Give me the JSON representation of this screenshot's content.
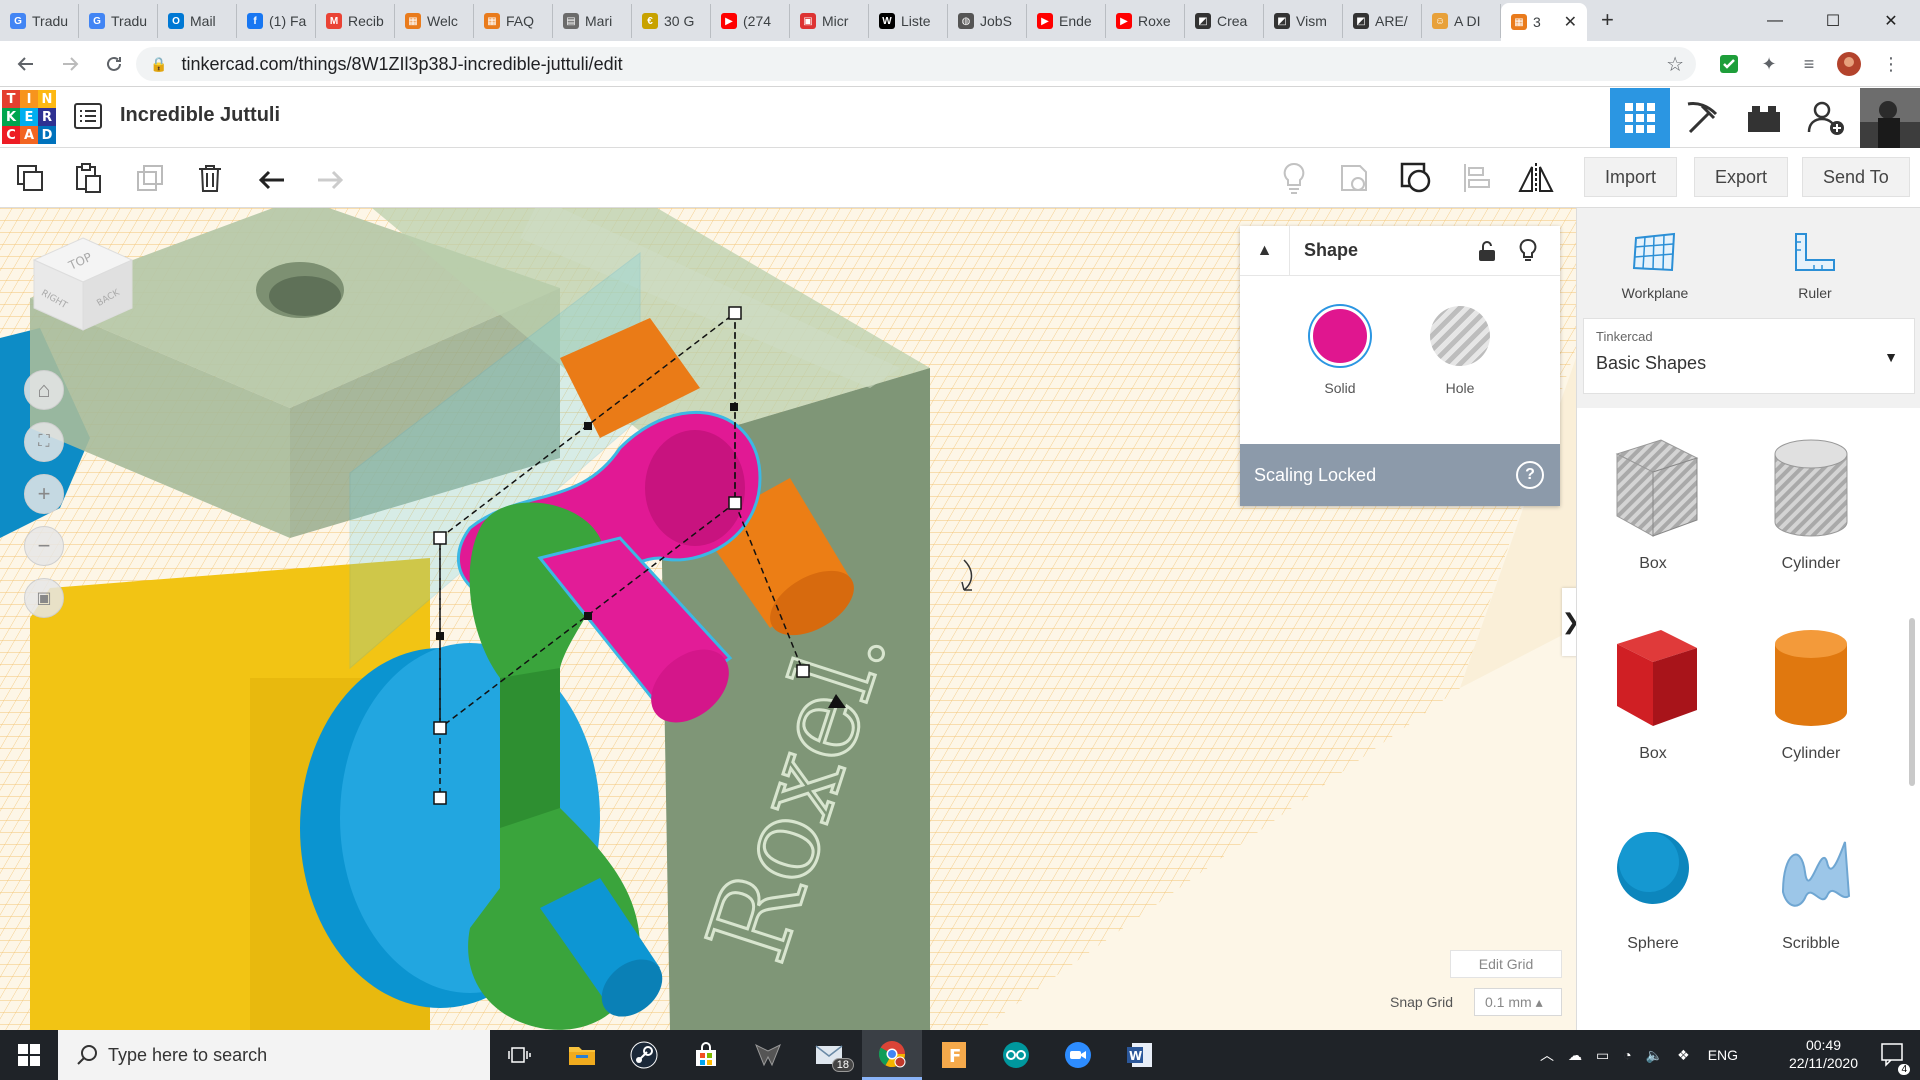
{
  "browser": {
    "tabs": [
      {
        "label": "Tradu",
        "color": "#4285f4",
        "glyph": "G"
      },
      {
        "label": "Tradu",
        "color": "#4285f4",
        "glyph": "G"
      },
      {
        "label": "Mail",
        "color": "#0078d4",
        "glyph": "O"
      },
      {
        "label": "(1) Fa",
        "color": "#1877f2",
        "glyph": "f"
      },
      {
        "label": "Recib",
        "color": "#ea4335",
        "glyph": "M"
      },
      {
        "label": "Welc",
        "color": "#e97b1c",
        "glyph": "▦"
      },
      {
        "label": "FAQ",
        "color": "#e97b1c",
        "glyph": "▦"
      },
      {
        "label": "Mari",
        "color": "#6b6b6b",
        "glyph": "▤"
      },
      {
        "label": "30 G",
        "color": "#c8a200",
        "glyph": "€"
      },
      {
        "label": "(274",
        "color": "#ff0000",
        "glyph": "▶"
      },
      {
        "label": "Micr",
        "color": "#d33",
        "glyph": "▣"
      },
      {
        "label": "Liste",
        "color": "#000",
        "glyph": "W"
      },
      {
        "label": "JobS",
        "color": "#555",
        "glyph": "◍"
      },
      {
        "label": "Ende",
        "color": "#ff0000",
        "glyph": "▶"
      },
      {
        "label": "Roxe",
        "color": "#ff0000",
        "glyph": "▶"
      },
      {
        "label": "Crea",
        "color": "#333",
        "glyph": "◩"
      },
      {
        "label": "Vism",
        "color": "#333",
        "glyph": "◩"
      },
      {
        "label": "ARE/",
        "color": "#333",
        "glyph": "◩"
      },
      {
        "label": "A DI",
        "color": "#e8a13a",
        "glyph": "☺"
      }
    ],
    "active_tab": {
      "label": "3",
      "color": "#e97b1c",
      "glyph": "▦",
      "close": "✕"
    },
    "new_tab": "+",
    "window_controls": {
      "minimize": "—",
      "maximize": "☐",
      "close": "✕"
    },
    "url": "tinkercad.com/things/8W1ZIl3p38J-incredible-juttuli/edit"
  },
  "app": {
    "logo_letters": [
      "T",
      "I",
      "N",
      "K",
      "E",
      "R",
      "C",
      "A",
      "D"
    ],
    "logo_colors": [
      "#e43f2f",
      "#f7941d",
      "#fdb813",
      "#00a54f",
      "#00aeef",
      "#2e3192",
      "#ed1c24",
      "#f26522",
      "#0072bc"
    ],
    "design_title": "Incredible Juttuli",
    "toolbar_buttons": {
      "import": "Import",
      "export": "Export",
      "send_to": "Send To"
    }
  },
  "inspector": {
    "title": "Shape",
    "solid_label": "Solid",
    "hole_label": "Hole",
    "solid_color": "#e0168f",
    "scaling_text": "Scaling Locked",
    "help": "?"
  },
  "grid": {
    "edit_grid": "Edit Grid",
    "snap_label": "Snap Grid",
    "snap_value": "0.1 mm ▴"
  },
  "panel": {
    "workplane": "Workplane",
    "ruler": "Ruler",
    "library_caption": "Tinkercad",
    "library_value": "Basic Shapes",
    "shapes": [
      {
        "label": "Box",
        "kind": "box-hole"
      },
      {
        "label": "Cylinder",
        "kind": "cyl-hole"
      },
      {
        "label": "Box",
        "kind": "box-red"
      },
      {
        "label": "Cylinder",
        "kind": "cyl-orange"
      },
      {
        "label": "Sphere",
        "kind": "sphere"
      },
      {
        "label": "Scribble",
        "kind": "scribble"
      }
    ]
  },
  "taskbar": {
    "search_placeholder": "Type here to search",
    "mail_badge": "18",
    "lang": "ENG",
    "time": "00:49",
    "date": "22/11/2020",
    "notifications": "4"
  }
}
